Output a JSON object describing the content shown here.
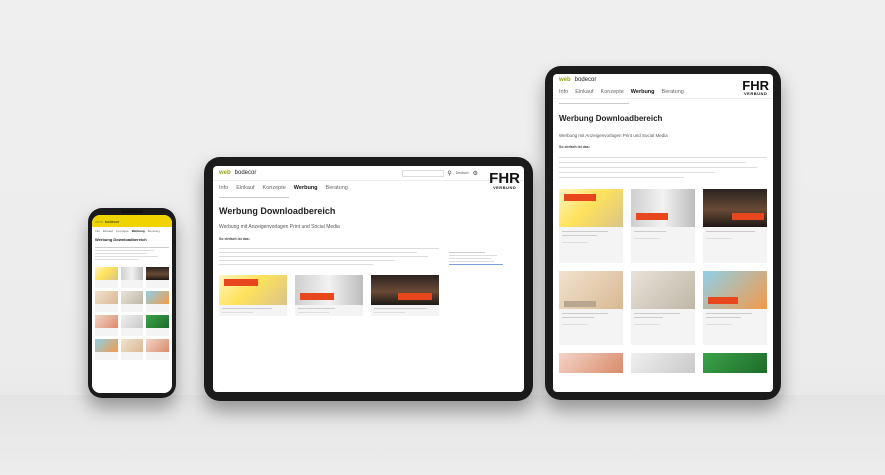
{
  "brand": {
    "logo_primary": "web",
    "logo_secondary": "bodecor",
    "fhr_logo": "FHR",
    "fhr_sub": "VERBUND"
  },
  "nav": [
    "Info",
    "Einkauf",
    "Konzepte",
    "Werbung",
    "Beratung"
  ],
  "active_nav": "Werbung",
  "page": {
    "title": "Werbung Downloadbereich",
    "subtitle": "Werbung mit Anzeigenvorlagen Print und Social Media",
    "intro_heading": "So einfach ist das:"
  },
  "header_tools": {
    "search_icon": "search-icon",
    "language": "Deutsch",
    "settings_icon": "gear-icon"
  },
  "colors": {
    "accent_yellow": "#f0d400",
    "brand_green": "#9aa51c",
    "tag_orange": "#e8461c"
  }
}
